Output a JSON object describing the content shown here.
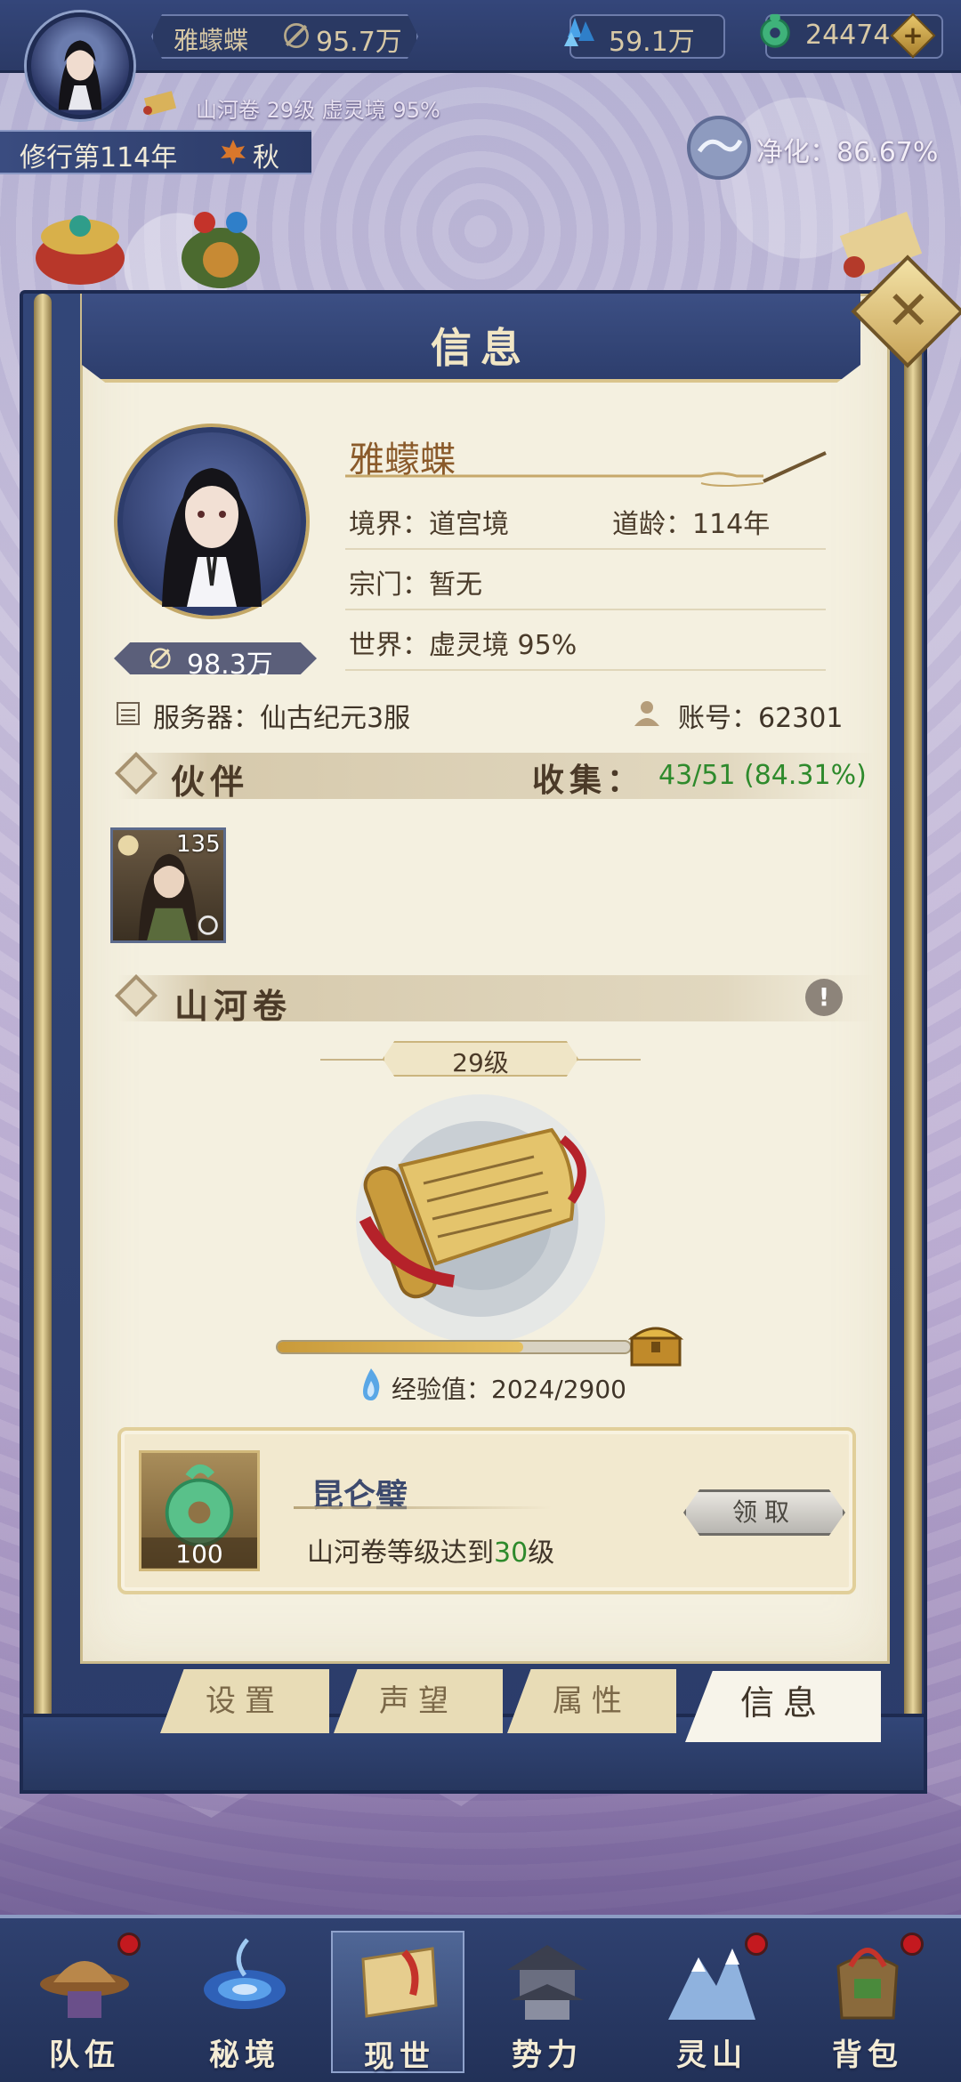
{
  "hud": {
    "player_name": "雅蠓蝶",
    "power": "95.7万",
    "gems": "59.1万",
    "jade": "24474",
    "add_symbol": "+",
    "sub_status": "山河卷 29级 虚灵境 95%",
    "cultivation_year": "修行第114年",
    "season": "秋",
    "purify": "净化：86.67%"
  },
  "panel": {
    "title": "信息",
    "close_symbol": "✕",
    "profile": {
      "name": "雅蠓蝶",
      "power": "98.3万",
      "realm": "境界：道宫境",
      "age": "道龄：114年",
      "sect": "宗门：暂无",
      "world": "世界：虚灵境  95%",
      "server": "服务器：仙古纪元3服",
      "account": "账号：62301"
    },
    "companions": {
      "title": "伙伴",
      "collect_label": "收集：",
      "collect_value": "43/51 (84.31%)",
      "items": [
        {
          "level": "135"
        }
      ]
    },
    "scroll": {
      "title": "山河卷",
      "info_symbol": "!",
      "level": "29级",
      "exp_label": "经验值：2024/2900",
      "exp_progress": 0.698
    },
    "reward": {
      "name": "昆仑璧",
      "count": "100",
      "desc_prefix": "山河卷等级达到",
      "desc_level": "30",
      "desc_suffix": "级",
      "claim_label": "领取"
    },
    "tabs": [
      {
        "label": "设置",
        "active": false
      },
      {
        "label": "声望",
        "active": false
      },
      {
        "label": "属性",
        "active": false
      },
      {
        "label": "信息",
        "active": true
      }
    ]
  },
  "bottom_nav": [
    {
      "label": "队伍",
      "badge": true
    },
    {
      "label": "秘境",
      "badge": false
    },
    {
      "label": "现世",
      "badge": false,
      "selected": true
    },
    {
      "label": "势力",
      "badge": false
    },
    {
      "label": "灵山",
      "badge": true
    },
    {
      "label": "背包",
      "badge": true
    }
  ],
  "colors": {
    "navy": "#2b3a66",
    "paper": "#f4f0e0",
    "gold": "#c9a559",
    "green_text": "#2e8a2c",
    "badge_red": "#c4191f"
  }
}
